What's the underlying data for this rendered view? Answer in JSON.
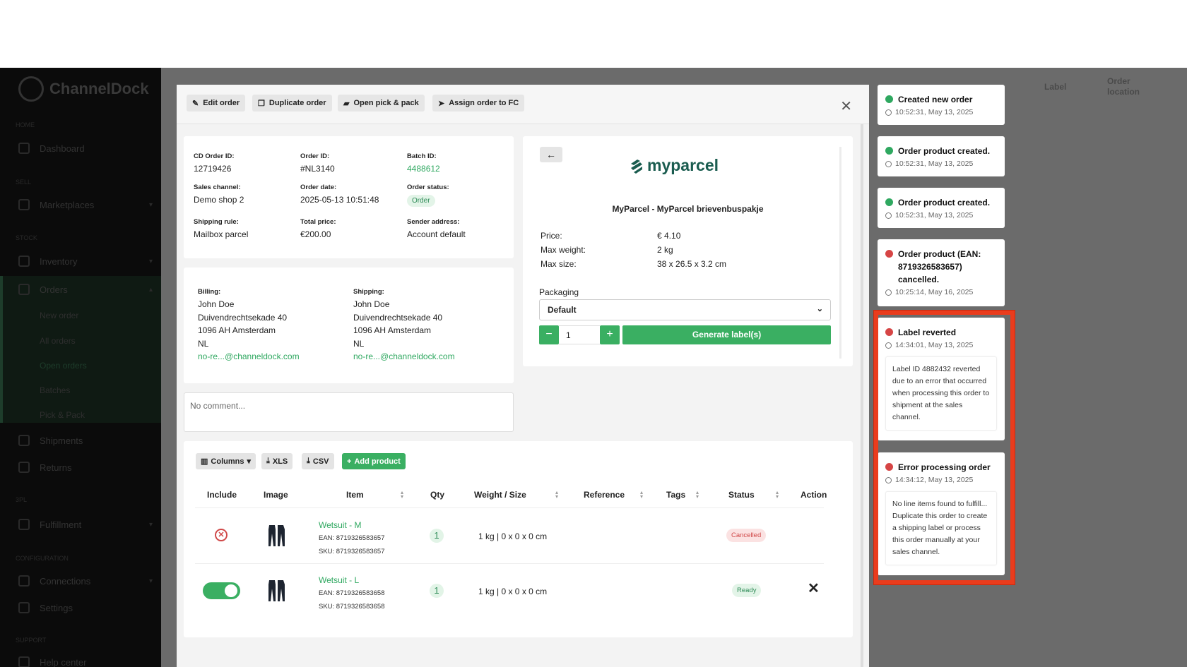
{
  "sidebar": {
    "brand": "ChannelDock",
    "sections": [
      "Home",
      "Sell",
      "Stock",
      "3PL",
      "Configuration",
      "Support"
    ],
    "items": [
      {
        "label": "Dashboard"
      },
      {
        "label": "Marketplaces"
      },
      {
        "label": "Inventory"
      },
      {
        "label": "Orders"
      },
      {
        "label": "Shipments"
      },
      {
        "label": "Returns"
      },
      {
        "label": "Fulfillment"
      },
      {
        "label": "Connections"
      },
      {
        "label": "Settings"
      },
      {
        "label": "Help center"
      }
    ],
    "subitems": [
      "New order",
      "All orders",
      "Open orders",
      "Batches",
      "Pick & Pack"
    ]
  },
  "background": {
    "col_label": "Label",
    "col_order_location": "Order location"
  },
  "toolbar": {
    "edit": "Edit order",
    "duplicate": "Duplicate order",
    "pickpack": "Open pick & pack",
    "assign": "Assign order to FC"
  },
  "order": {
    "cd_order_id_label": "CD Order ID:",
    "cd_order_id": "12719426",
    "order_id_label": "Order ID:",
    "order_id": "#NL3140",
    "batch_id_label": "Batch ID:",
    "batch_id": "4488612",
    "sales_channel_label": "Sales channel:",
    "sales_channel": "Demo shop 2",
    "order_date_label": "Order date:",
    "order_date": "2025-05-13 10:51:48",
    "order_status_label": "Order status:",
    "order_status": "Order",
    "shipping_rule_label": "Shipping rule:",
    "shipping_rule": "Mailbox parcel",
    "total_price_label": "Total price:",
    "total_price": "€200.00",
    "sender_address_label": "Sender address:",
    "sender_address": "Account default"
  },
  "billing": {
    "label": "Billing:",
    "name": "John Doe",
    "street": "Duivendrechtsekade 40",
    "city": "1096 AH Amsterdam",
    "country": "NL",
    "email": "no-re...@channeldock.com"
  },
  "shipping": {
    "label": "Shipping:",
    "name": "John Doe",
    "street": "Duivendrechtsekade 40",
    "city": "1096 AH Amsterdam",
    "country": "NL",
    "email": "no-re...@channeldock.com"
  },
  "comment": {
    "placeholder": "No comment..."
  },
  "carrier": {
    "logo_text": "myparcel",
    "service": "MyParcel - MyParcel brievenbuspakje",
    "price_label": "Price:",
    "price": "€ 4.10",
    "weight_label": "Max weight:",
    "weight": "2 kg",
    "size_label": "Max size:",
    "size": "38 x 26.5 x 3.2 cm",
    "packaging_label": "Packaging",
    "packaging_value": "Default",
    "minus": "−",
    "plus": "+",
    "quantity": "1",
    "generate": "Generate label(s)"
  },
  "products": {
    "columns_btn": "Columns",
    "xls": "XLS",
    "csv": "CSV",
    "add": "Add product",
    "headers": [
      "Include",
      "Image",
      "Item",
      "Qty",
      "Weight / Size",
      "Reference",
      "Tags",
      "Status",
      "Action"
    ],
    "rows": [
      {
        "name": "Wetsuit - M",
        "ean": "EAN: 8719326583657",
        "sku": "SKU: 8719326583657",
        "qty": "1",
        "weight": "1 kg | 0 x 0 x 0 cm",
        "status": "Cancelled"
      },
      {
        "name": "Wetsuit - L",
        "ean": "EAN: 8719326583658",
        "sku": "SKU: 8719326583658",
        "qty": "1",
        "weight": "1 kg | 0 x 0 x 0 cm",
        "status": "Ready"
      }
    ]
  },
  "timeline": [
    {
      "title": "Created new order",
      "time": "10:52:31, May 13, 2025",
      "type": "ok"
    },
    {
      "title": "Order product created.",
      "time": "10:52:31, May 13, 2025",
      "type": "ok"
    },
    {
      "title": "Order product created.",
      "time": "10:52:31, May 13, 2025",
      "type": "ok"
    },
    {
      "title": "Order product (EAN: 8719326583657) cancelled.",
      "time": "10:25:14, May 16, 2025",
      "type": "error"
    },
    {
      "title": "Label reverted",
      "time": "14:34:01, May 13, 2025",
      "type": "error",
      "message": "Label ID 4882432 reverted due to an error that occurred when processing this order to shipment at the sales channel."
    },
    {
      "title": "Error processing order",
      "time": "14:34:12, May 13, 2025",
      "type": "error",
      "message": "No line items found to fulfill... Duplicate this order to create a shipping label or process this order manually at your sales channel."
    }
  ],
  "colors": {
    "accent": "#3aaf62",
    "error": "#d64545",
    "highlight": "#ea3c1d"
  }
}
